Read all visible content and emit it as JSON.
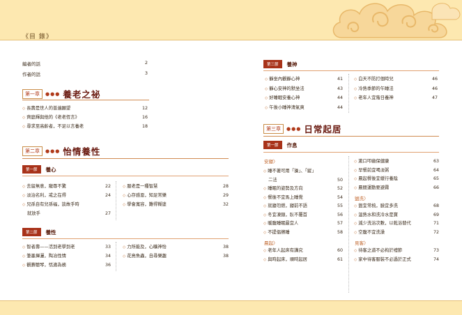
{
  "book_title": "《目 錄》",
  "front_matter": [
    {
      "text": "編者的話",
      "page": "2"
    },
    {
      "text": "作者的話",
      "page": "3"
    }
  ],
  "chapter1": {
    "label": "第一章",
    "dots": "●●●",
    "title": "養老之祕",
    "entries": [
      {
        "text": "長壽是世人的普遍願望",
        "page": "12"
      },
      {
        "text": "齊庭輝與他的《老老恆言》",
        "page": "16"
      },
      {
        "text": "尋求至高齡者，不足以言養老",
        "page": "18"
      }
    ]
  },
  "chapter2": {
    "label": "第二章",
    "dots": "●●●",
    "title": "怡情養性",
    "section1": {
      "tag": "第一節",
      "name": "養心",
      "left": [
        {
          "text": "去留無意，寵辱不驚",
          "page": "22"
        },
        {
          "text": "淡泊名利，戒之在得",
          "page": "24"
        },
        {
          "text": "兄孫自有兒孫福，談故手時",
          "page": ""
        },
        {
          "text": "就放手",
          "page": "27",
          "cont": true
        }
      ],
      "right": [
        {
          "text": "服老是一種智慧",
          "page": "28"
        },
        {
          "text": "心存感恩，知足常樂",
          "page": "29"
        },
        {
          "text": "學會寬容，難得糊塗",
          "page": "32"
        }
      ]
    },
    "section2": {
      "tag": "第二節",
      "name": "養性",
      "left": [
        {
          "text": "智者壽——活到老學到老",
          "page": "33"
        },
        {
          "text": "筆墨揮灑，陶冶性情",
          "page": "34"
        },
        {
          "text": "觀賽聽琴，恬適為務",
          "page": "36"
        }
      ],
      "right": [
        {
          "text": "力所能及，心曠神怡",
          "page": "38"
        },
        {
          "text": "花鳥魚蟲，自尋樂趣",
          "page": "38"
        }
      ]
    }
  },
  "section3": {
    "tag": "第三節",
    "name": "養神",
    "left": [
      {
        "text": "靜坐內觀靜心神",
        "page": "41"
      },
      {
        "text": "靜心安神的默坐法",
        "page": "43"
      },
      {
        "text": "好睡眠安養心神",
        "page": "44"
      },
      {
        "text": "午後小睡神清氣爽",
        "page": "44"
      }
    ],
    "right": [
      {
        "text": "白天不防打個時兒",
        "page": "46"
      },
      {
        "text": "冷熱季節的午睡法",
        "page": "46"
      },
      {
        "text": "老年人宜階日養神",
        "page": "47"
      }
    ]
  },
  "chapter3": {
    "label": "第三章",
    "dots": "●●●",
    "title": "日常起居",
    "section1": {
      "tag": "第一節",
      "name": "作息",
      "left": [
        {
          "type": "sub",
          "text": "安寢〉"
        },
        {
          "text": "睡不著可用「操」、「縱」",
          "page": ""
        },
        {
          "text": "二法",
          "page": "50",
          "cont": true
        },
        {
          "text": "睡眠的姿勢及方向",
          "page": "52"
        },
        {
          "text": "餐後不宜馬上睡覺",
          "page": "54"
        },
        {
          "text": "就寢勿燃，寢前不語",
          "page": "55"
        },
        {
          "text": "冬宜凍頸，臥不覆首",
          "page": "56"
        },
        {
          "text": "暖腹睡眠最宜人",
          "page": "57"
        },
        {
          "text": "不提倡擦睡",
          "page": "58"
        },
        {
          "type": "sub",
          "text": "晨起〉"
        },
        {
          "text": "老年人起床有講究",
          "page": "60"
        },
        {
          "text": "與時起床，順時起居",
          "page": "61"
        }
      ],
      "right": [
        {
          "text": "漱口叩齒保健康",
          "page": "63"
        },
        {
          "text": "早餐前宜喝淡粥",
          "page": "64"
        },
        {
          "text": "晨起餐後宜緩行養陰",
          "page": "65"
        },
        {
          "text": "晨間運動要避霧",
          "page": "66"
        },
        {
          "type": "sub",
          "text": "盥洗〉"
        },
        {
          "text": "盥宜常梳，臉宜多洗",
          "page": "68"
        },
        {
          "text": "溫熱水和洗冷水是寶",
          "page": "69"
        },
        {
          "text": "減少洗浴次數，以乾浴替代",
          "page": "71"
        },
        {
          "text": "空腹不宜洗澡",
          "page": "72"
        },
        {
          "type": "sub",
          "text": "見客〉"
        },
        {
          "text": "待客之道不必拘於禮節",
          "page": "73"
        },
        {
          "text": "家中待客服裝不必過於正式",
          "page": "74"
        }
      ]
    }
  }
}
